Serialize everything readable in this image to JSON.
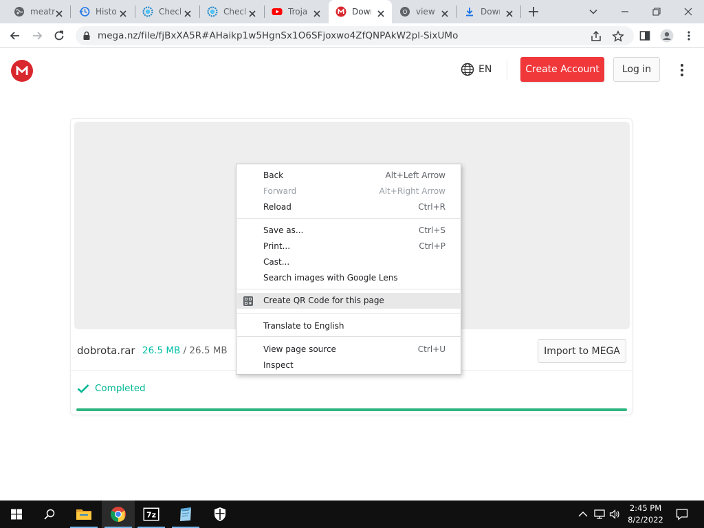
{
  "browser": {
    "tabs": [
      {
        "title": "meatr",
        "icon": "globe-icon"
      },
      {
        "title": "Histo",
        "icon": "history-icon"
      },
      {
        "title": "Check",
        "icon": "checker-gear-icon"
      },
      {
        "title": "Check",
        "icon": "checker-gear-icon"
      },
      {
        "title": "Trojan",
        "icon": "youtube-icon"
      },
      {
        "title": "Down",
        "icon": "mega-icon",
        "active": true
      },
      {
        "title": "view-",
        "icon": "chrome-icon"
      },
      {
        "title": "Down",
        "icon": "download-icon"
      }
    ],
    "url": "mega.nz/file/fjBxXA5R#AHaikp1w5HgnSx1O6SFjoxwo4ZfQNPAkW2pl-SixUMo"
  },
  "mega": {
    "lang": "EN",
    "create_account": "Create Account",
    "login": "Log in",
    "brand_color": "#d9272e",
    "accent_color": "#f0373a"
  },
  "file": {
    "name": "dobrota.rar",
    "downloaded": "26.5 MB",
    "separator": "/",
    "total": "26.5 MB",
    "import_label": "Import to MEGA",
    "status": "Completed",
    "progress": 1.0
  },
  "context_menu": {
    "groups": [
      [
        {
          "label": "Back",
          "shortcut": "Alt+Left Arrow"
        },
        {
          "label": "Forward",
          "shortcut": "Alt+Right Arrow",
          "disabled": true
        },
        {
          "label": "Reload",
          "shortcut": "Ctrl+R"
        }
      ],
      [
        {
          "label": "Save as...",
          "shortcut": "Ctrl+S"
        },
        {
          "label": "Print...",
          "shortcut": "Ctrl+P"
        },
        {
          "label": "Cast...",
          "shortcut": ""
        },
        {
          "label": "Search images with Google Lens",
          "shortcut": ""
        }
      ],
      [
        {
          "label": "Create QR Code for this page",
          "shortcut": "",
          "icon": "qr-code-icon",
          "highlighted": true
        }
      ],
      [
        {
          "label": "Translate to English",
          "shortcut": ""
        }
      ],
      [
        {
          "label": "View page source",
          "shortcut": "Ctrl+U"
        },
        {
          "label": "Inspect",
          "shortcut": ""
        }
      ]
    ]
  },
  "taskbar": {
    "apps": [
      "start-icon",
      "search-icon",
      "file-explorer-icon",
      "chrome-icon",
      "7zip-icon",
      "notepad-icon",
      "defender-icon"
    ],
    "active_app": "chrome-icon",
    "time": "2:45 PM",
    "date": "8/2/2022"
  }
}
